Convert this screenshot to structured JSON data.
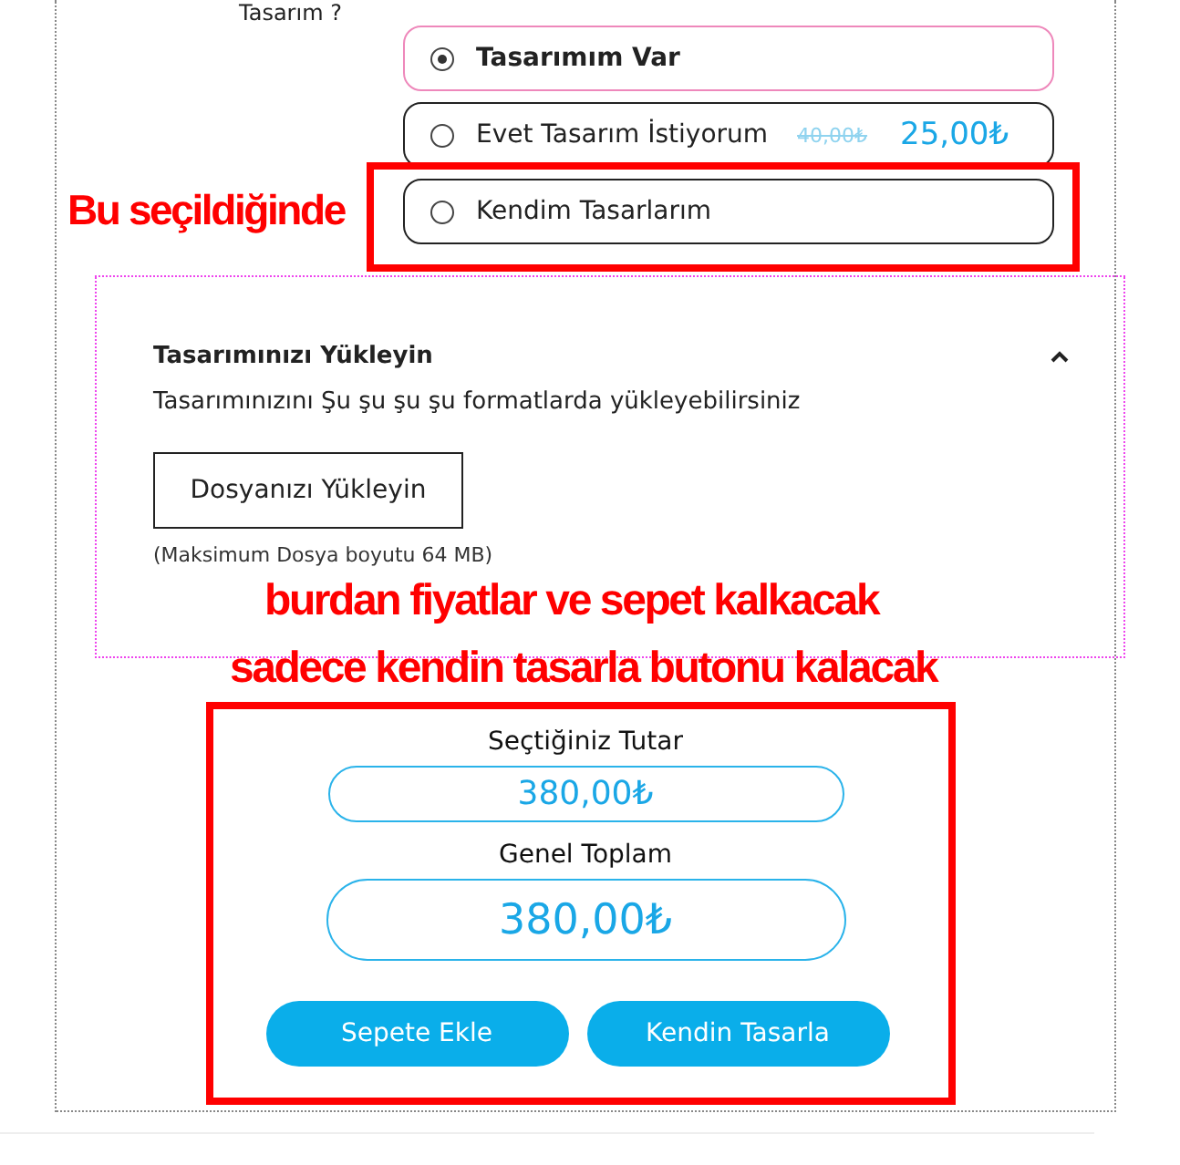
{
  "question": "Tasarım ?",
  "options": [
    {
      "label": "Tasarımım Var",
      "selected": true
    },
    {
      "label": "Evet Tasarım İstiyorum",
      "selected": false,
      "old_price": "40,00₺",
      "price": "25,00₺"
    },
    {
      "label": "Kendim Tasarlarım",
      "selected": false
    }
  ],
  "upload": {
    "title": "Tasarımınızı Yükleyin",
    "expanded": true,
    "description": "Tasarımınızını Şu şu şu şu formatlarda yükleyebilirsiniz",
    "button": "Dosyanızı Yükleyin",
    "note": "(Maksimum Dosya boyutu 64 MB)"
  },
  "summary": {
    "selected_label": "Seçtiğiniz Tutar",
    "selected_amount": "380,00₺",
    "total_label": "Genel Toplam",
    "total_amount": "380,00₺",
    "buttons": [
      "Sepete Ekle",
      "Kendin Tasarla"
    ]
  },
  "annotations": [
    {
      "kind": "text",
      "text": "Bu seçildiğinde"
    },
    {
      "kind": "box"
    },
    {
      "kind": "text",
      "text": "burdan fiyatlar ve sepet kalkacak"
    },
    {
      "kind": "text",
      "text": "sadece kendin tasarla butonu kalacak"
    },
    {
      "kind": "box"
    }
  ]
}
